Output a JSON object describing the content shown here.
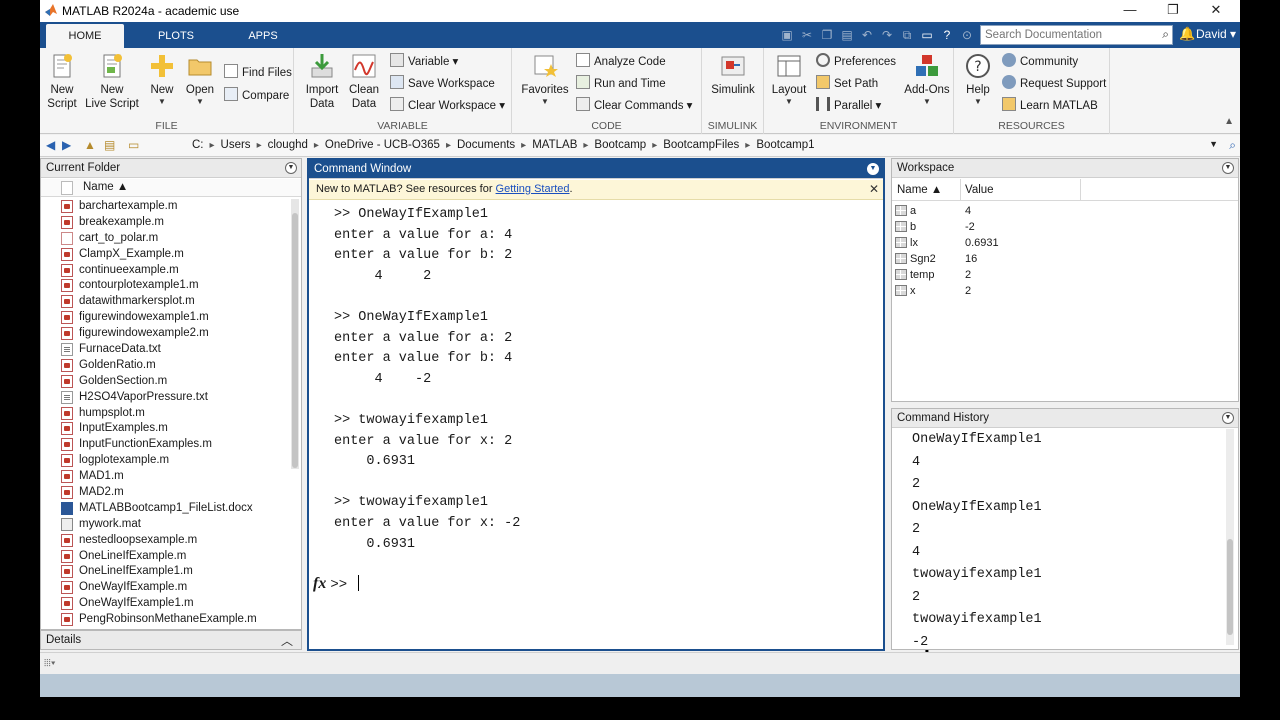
{
  "window": {
    "title": "MATLAB R2024a - academic use",
    "minimize": "—",
    "maximize": "❐",
    "close": "✕"
  },
  "tabs": [
    "HOME",
    "PLOTS",
    "APPS"
  ],
  "search": {
    "placeholder": "Search Documentation"
  },
  "user": {
    "name": "David ▾"
  },
  "ribbon": {
    "file": {
      "label": "FILE",
      "new_script": "New\nScript",
      "new_live_script": "New\nLive Script",
      "new": "New",
      "open": "Open",
      "find_files": "Find Files",
      "compare": "Compare"
    },
    "variable": {
      "label": "VARIABLE",
      "import_data": "Import\nData",
      "clean_data": "Clean\nData",
      "variable": "Variable",
      "save_workspace": "Save Workspace",
      "clear_workspace": "Clear Workspace"
    },
    "code": {
      "label": "CODE",
      "favorites": "Favorites",
      "analyze_code": "Analyze Code",
      "run_and_time": "Run and Time",
      "clear_commands": "Clear Commands"
    },
    "simulink": {
      "label": "SIMULINK",
      "simulink": "Simulink"
    },
    "environment": {
      "label": "ENVIRONMENT",
      "layout": "Layout",
      "preferences": "Preferences",
      "set_path": "Set Path",
      "parallel": "Parallel",
      "add_ons": "Add-Ons"
    },
    "resources": {
      "label": "RESOURCES",
      "help": "Help",
      "community": "Community",
      "request_support": "Request Support",
      "learn_matlab": "Learn MATLAB"
    }
  },
  "path": [
    "C:",
    "Users",
    "cloughd",
    "OneDrive - UCB-O365",
    "Documents",
    "MATLAB",
    "Bootcamp",
    "BootcampFiles",
    "Bootcamp1"
  ],
  "current_folder": {
    "title": "Current Folder",
    "column": "Name ▲",
    "files": [
      {
        "name": "barchartexample.m",
        "type": "m"
      },
      {
        "name": "breakexample.m",
        "type": "m"
      },
      {
        "name": "cart_to_polar.m",
        "type": "mlx"
      },
      {
        "name": "ClampX_Example.m",
        "type": "m"
      },
      {
        "name": "continueexample.m",
        "type": "m"
      },
      {
        "name": "contourplotexample1.m",
        "type": "m"
      },
      {
        "name": "datawithmarkersplot.m",
        "type": "m"
      },
      {
        "name": "figurewindowexample1.m",
        "type": "m"
      },
      {
        "name": "figurewindowexample2.m",
        "type": "m"
      },
      {
        "name": "FurnaceData.txt",
        "type": "txt"
      },
      {
        "name": "GoldenRatio.m",
        "type": "m"
      },
      {
        "name": "GoldenSection.m",
        "type": "m"
      },
      {
        "name": "H2SO4VaporPressure.txt",
        "type": "txt"
      },
      {
        "name": "humpsplot.m",
        "type": "m"
      },
      {
        "name": "InputExamples.m",
        "type": "m"
      },
      {
        "name": "InputFunctionExamples.m",
        "type": "m"
      },
      {
        "name": "logplotexample.m",
        "type": "m"
      },
      {
        "name": "MAD1.m",
        "type": "m"
      },
      {
        "name": "MAD2.m",
        "type": "m"
      },
      {
        "name": "MATLABBootcamp1_FileList.docx",
        "type": "doc"
      },
      {
        "name": "mywork.mat",
        "type": "mat"
      },
      {
        "name": "nestedloopsexample.m",
        "type": "m"
      },
      {
        "name": "OneLineIfExample.m",
        "type": "m"
      },
      {
        "name": "OneLineIfExample1.m",
        "type": "m"
      },
      {
        "name": "OneWayIfExample.m",
        "type": "m"
      },
      {
        "name": "OneWayIfExample1.m",
        "type": "m"
      },
      {
        "name": "PengRobinsonMethaneExample.m",
        "type": "m"
      }
    ]
  },
  "details": {
    "label": "Details"
  },
  "command_window": {
    "title": "Command Window",
    "banner_text": "New to MATLAB? See resources for ",
    "banner_link": "Getting Started",
    "banner_end": ".",
    "lines": [
      ">> OneWayIfExample1",
      "enter a value for a: 4",
      "enter a value for b: 2",
      "     4     2",
      "",
      ">> OneWayIfExample1",
      "enter a value for a: 2",
      "enter a value for b: 4",
      "     4    -2",
      "",
      ">> twowayifexample1",
      "enter a value for x: 2",
      "    0.6931",
      "",
      ">> twowayifexample1",
      "enter a value for x: -2",
      "    0.6931"
    ],
    "prompt_fx": "fx",
    "prompt": ">>"
  },
  "workspace": {
    "title": "Workspace",
    "col_name": "Name ▲",
    "col_value": "Value",
    "vars": [
      {
        "name": "a",
        "value": "4"
      },
      {
        "name": "b",
        "value": "-2"
      },
      {
        "name": "lx",
        "value": "0.6931"
      },
      {
        "name": "Sgn2",
        "value": "16"
      },
      {
        "name": "temp",
        "value": "2"
      },
      {
        "name": "x",
        "value": "2"
      }
    ]
  },
  "history": {
    "title": "Command History",
    "lines": [
      "OneWayIfExample1",
      "4",
      "2",
      "OneWayIfExample1",
      "2",
      "4",
      "twowayifexample1",
      "2",
      "twowayifexample1",
      "-2"
    ]
  },
  "colors": {
    "accent": "#1b4f8e",
    "banner": "#fdf6d8"
  }
}
